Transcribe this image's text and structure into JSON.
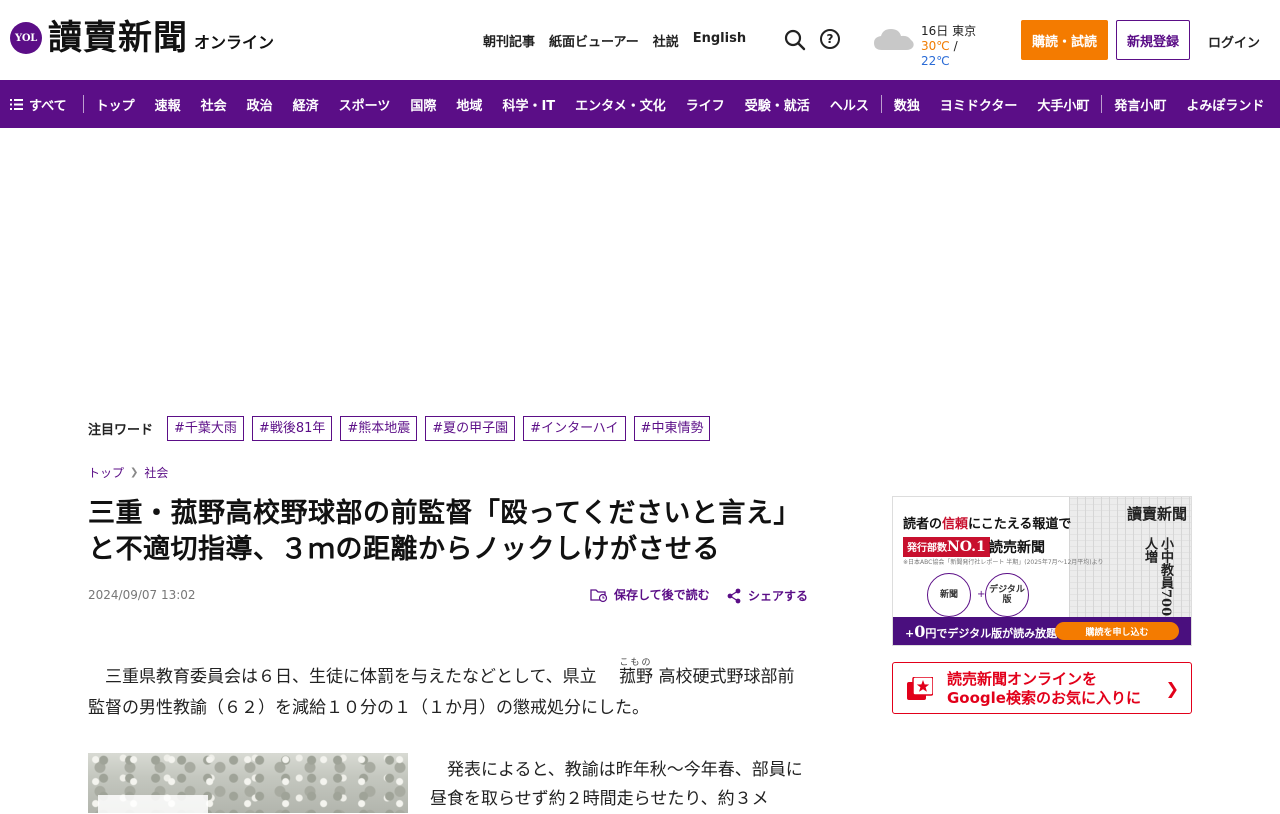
{
  "header": {
    "logo_badge": "YOL",
    "logo_title": "讀賣新聞",
    "logo_sub": "オンライン",
    "links": [
      "朝刊記事",
      "紙面ビューアー",
      "社説",
      "English"
    ],
    "weather": {
      "date_city": "16日 東京",
      "high": "30℃",
      "separator": "/",
      "low": "22℃",
      "icon": "cloud-icon"
    },
    "subscribe_label": "購読・試読",
    "register_label": "新規登録",
    "login_label": "ログイン",
    "help_glyph": "?"
  },
  "nav": {
    "all_label": "すべて",
    "items_a": [
      "トップ",
      "速報",
      "社会",
      "政治",
      "経済",
      "スポーツ",
      "国際",
      "地域",
      "科学・IT",
      "エンタメ・文化",
      "ライフ",
      "受験・就活",
      "ヘルス"
    ],
    "items_b": [
      "数独",
      "ヨミドクター",
      "大手小町"
    ],
    "items_c": [
      "発言小町",
      "よみぽランド"
    ]
  },
  "trending": {
    "label": "注目ワード",
    "tags": [
      "#千葉大雨",
      "#戦後81年",
      "#熊本地震",
      "#夏の甲子園",
      "#インターハイ",
      "#中東情勢"
    ]
  },
  "breadcrumb": {
    "home": "トップ",
    "category": "社会"
  },
  "article": {
    "headline": "三重・菰野高校野球部の前監督「殴ってくださいと言え」と不適切指導、３ｍの距離からノックしけがさせる",
    "date": "2024/09/07 13:02",
    "save_label": "保存して後で読む",
    "share_label": "シェアする",
    "lead_before": "三重県教育委員会は６日、生徒に体罰を与えたなどとして、県立 ",
    "lead_ruby_base": "菰野",
    "lead_ruby_text": "こもの",
    "lead_after": " 高校硬式野球部前監督の男性教諭（６２）を減給１０分の１（１か月）の懲戒処分にした。",
    "body": "発表によると、教諭は昨年秋～今年春、部員に昼食を取らせず約２時間走らせたり、約３メ"
  },
  "sidebar": {
    "ad": {
      "headline_pre": "読者の",
      "headline_red": "信頼",
      "headline_post": "にこたえる報道で",
      "badge_pre": "発行部数",
      "badge_no": "NO.1",
      "brand": "読売新聞",
      "note": "※日本ABC協会「新聞発行社レポート 半期」(2025年7月～12月平均)より",
      "paper_title": "讀賣新聞",
      "paper_head": "小中教員700人増",
      "circle_1": "新聞",
      "circle_2": "デジタル版",
      "plus": "+",
      "strip_pre": "+",
      "strip_zero": "0",
      "strip_post": "円でデジタル版が読み放題！",
      "cta": "購読を申し込む"
    },
    "google": {
      "line1": "読売新聞オンラインを",
      "line2": "Google検索のお気に入りに"
    }
  },
  "colors": {
    "brand_purple": "#5b0e87",
    "orange": "#f47b00",
    "red": "#e2001a"
  }
}
